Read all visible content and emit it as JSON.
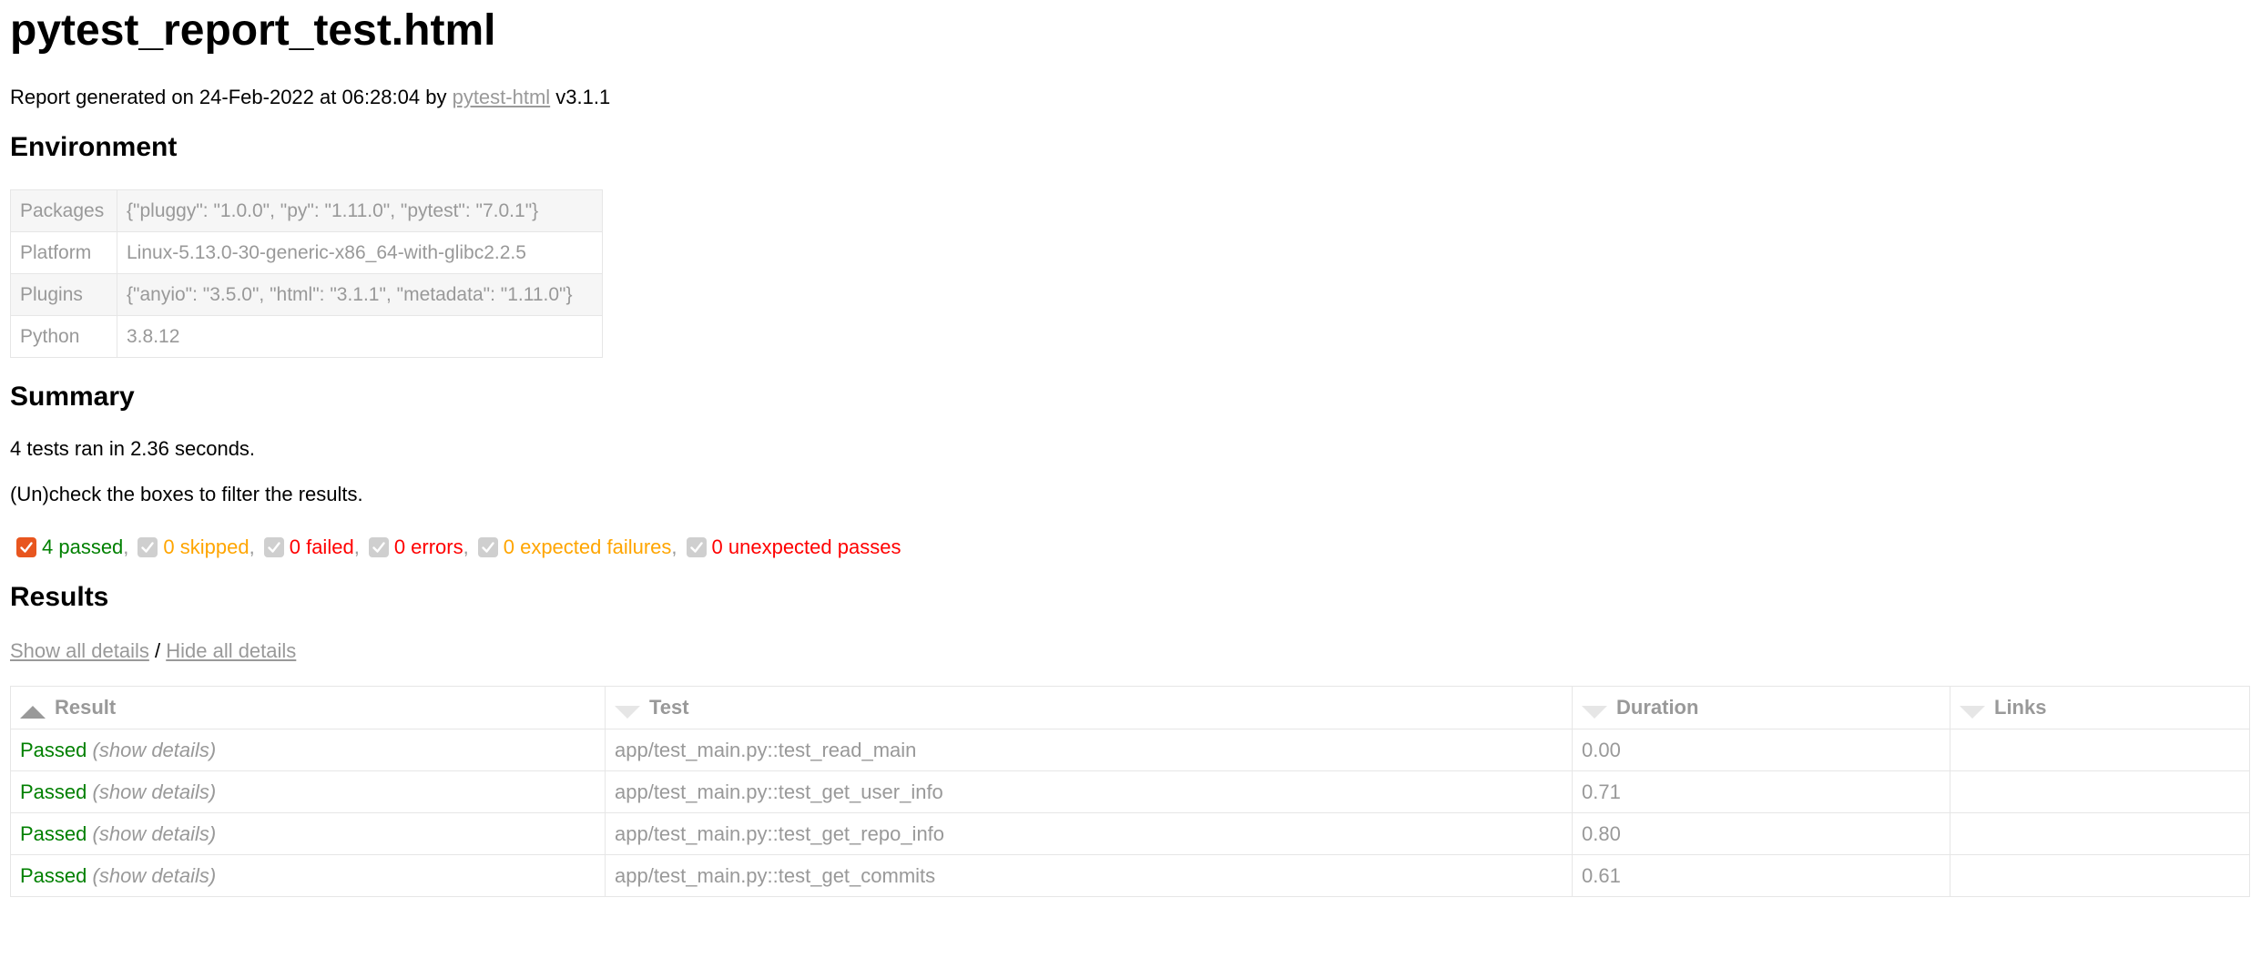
{
  "title": "pytest_report_test.html",
  "generated": {
    "prefix": "Report generated on 24-Feb-2022 at 06:28:04 by ",
    "link_text": "pytest-html",
    "suffix": " v3.1.1"
  },
  "environment": {
    "heading": "Environment",
    "rows": [
      {
        "key": "Packages",
        "value": "{\"pluggy\": \"1.0.0\", \"py\": \"1.11.0\", \"pytest\": \"7.0.1\"}"
      },
      {
        "key": "Platform",
        "value": "Linux-5.13.0-30-generic-x86_64-with-glibc2.2.5"
      },
      {
        "key": "Plugins",
        "value": "{\"anyio\": \"3.5.0\", \"html\": \"3.1.1\", \"metadata\": \"1.11.0\"}"
      },
      {
        "key": "Python",
        "value": "3.8.12"
      }
    ]
  },
  "summary": {
    "heading": "Summary",
    "ran_text": "4 tests ran in 2.36 seconds.",
    "filter_hint": "(Un)check the boxes to filter the results.",
    "filters": [
      {
        "label": "4 passed",
        "checked": true,
        "enabled": true
      },
      {
        "label": "0 skipped",
        "checked": true,
        "enabled": false
      },
      {
        "label": "0 failed",
        "checked": true,
        "enabled": false
      },
      {
        "label": "0 errors",
        "checked": true,
        "enabled": false
      },
      {
        "label": "0 expected failures",
        "checked": true,
        "enabled": false
      },
      {
        "label": "0 unexpected passes",
        "checked": true,
        "enabled": false
      }
    ],
    "comma": ","
  },
  "results": {
    "heading": "Results",
    "show_all": "Show all details",
    "separator": " / ",
    "hide_all": "Hide all details",
    "columns": [
      "Result",
      "Test",
      "Duration",
      "Links"
    ],
    "rows": [
      {
        "result": "Passed",
        "details": "(show details)",
        "test": "app/test_main.py::test_read_main",
        "duration": "0.00",
        "links": ""
      },
      {
        "result": "Passed",
        "details": "(show details)",
        "test": "app/test_main.py::test_get_user_info",
        "duration": "0.71",
        "links": ""
      },
      {
        "result": "Passed",
        "details": "(show details)",
        "test": "app/test_main.py::test_get_repo_info",
        "duration": "0.80",
        "links": ""
      },
      {
        "result": "Passed",
        "details": "(show details)",
        "test": "app/test_main.py::test_get_commits",
        "duration": "0.61",
        "links": ""
      }
    ]
  },
  "colors": {
    "passed": "#008000",
    "skipped": "#ffa500",
    "failed": "#ff0000",
    "checkbox_checked": "#e8561f",
    "checkbox_disabled": "#cfcfcf",
    "muted": "#999999"
  }
}
